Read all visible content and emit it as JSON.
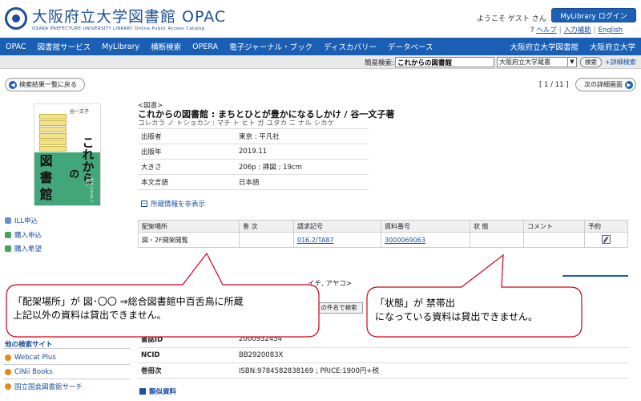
{
  "header": {
    "logo_title": "大阪府立大学図書館 OPAC",
    "logo_subtitle": "OSAKA PREFECTURE UNIVERSITY LIBRARY  Online Public Access Catalog",
    "welcome": "ようこそ  ゲスト さん",
    "login_button": "MyLibrary ログイン",
    "links": {
      "help": "ヘルプ",
      "input_help": "入力補助",
      "english": "English"
    }
  },
  "nav": {
    "items": [
      "OPAC",
      "図書館サービス",
      "MyLibrary",
      "横断検索",
      "OPERA",
      "電子ジャーナル・ブック",
      "ディスカバリー",
      "データベース"
    ],
    "right_items": [
      "大阪府立大学図書館",
      "大阪府立大学"
    ]
  },
  "quick_search": {
    "label": "簡易検索:",
    "value": "これからの図書館",
    "scope": "大阪府立大学蔵書",
    "button": "検索",
    "advanced": "+詳細検索"
  },
  "navigation": {
    "back": "検索結果一覧に戻る",
    "pager": "[ 1 / 11 ]",
    "next": "次の詳細画面"
  },
  "cover": {
    "author": "谷一文子",
    "title_a": "これから",
    "title_b": "の",
    "title_c": "図",
    "title_d": "書",
    "title_e": "館",
    "subtitle": "豊かにするしかけ"
  },
  "sidebar": {
    "items": [
      "ILL申込",
      "購入申込",
      "購入希望"
    ],
    "other_heading": "他の検索サイト",
    "other_items": [
      "Webcat Plus",
      "CiNii Books",
      "国立国会図書館サーチ"
    ]
  },
  "record": {
    "genre": "<図書>",
    "title": "これからの図書館 : まちとひとが豊かになるしかけ / 谷一文子著",
    "reading": "コレカラ ノ トショカン : マチ ト ヒト ガ ユタカ ニ ナル シカケ",
    "meta": [
      {
        "k": "出版者",
        "v": "東京 : 平凡社"
      },
      {
        "k": "出版年",
        "v": "2019.11"
      },
      {
        "k": "大きさ",
        "v": "206p : 挿図 ; 19cm"
      },
      {
        "k": "本文言語",
        "v": "日本語"
      }
    ],
    "holdings_toggle": "所蔵情報を非表示",
    "holdings": {
      "headers": [
        "配架場所",
        "巻 次",
        "請求記号",
        "資料番号",
        "状 態",
        "コメント",
        "予約"
      ],
      "row": {
        "location": "図・2F開架閲覧",
        "volume": "",
        "call_number": "016.2/TA87",
        "item_id": "3000069063",
        "status": "",
        "comment": ""
      }
    },
    "peek_text": "イチ, アヤコ>",
    "peek_button": "この件名で検索",
    "meta2": [
      {
        "k": "書誌ID",
        "v": "2000932454"
      },
      {
        "k": "NCID",
        "v": "BB2920083X"
      },
      {
        "k": "巻冊次",
        "v": "ISBN:9784582838169 ; PRICE:1900円+税"
      }
    ],
    "similar": "類似資料"
  },
  "callouts": {
    "left_line1": "「配架場所」が 図･〇〇 ⇒総合図書館中百舌鳥に所蔵",
    "left_line2": "上記以外の資料は貸出できません。",
    "right_line1": "「状態」が 禁帯出",
    "right_line2": "になっている資料は貸出できません。"
  },
  "colors": {
    "nav_blue": "#1a5fb4",
    "link_blue": "#1b4fa0",
    "callout_border": "#d0021b"
  }
}
